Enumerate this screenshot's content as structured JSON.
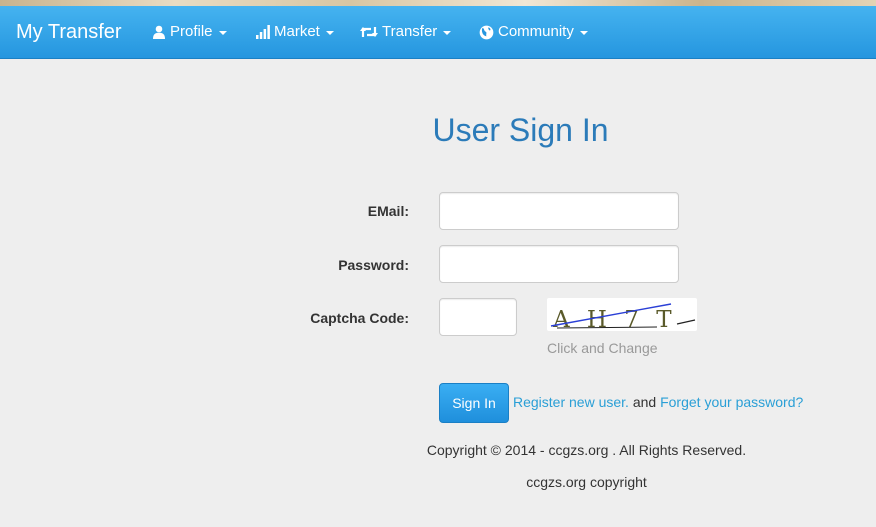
{
  "navbar": {
    "brand": "My Transfer",
    "items": [
      {
        "label": "Profile",
        "icon": "user-icon"
      },
      {
        "label": "Market",
        "icon": "signal-bars-icon"
      },
      {
        "label": "Transfer",
        "icon": "retweet-icon"
      },
      {
        "label": "Community",
        "icon": "globe-icon"
      }
    ]
  },
  "form": {
    "title": "User Sign In",
    "email_label": "EMail:",
    "email_value": "",
    "password_label": "Password:",
    "password_value": "",
    "captcha_label": "Captcha Code:",
    "captcha_value": "",
    "captcha_image_text": "A H 7 T",
    "captcha_hint": "Click and Change",
    "submit_label": "Sign In",
    "register_link": "Register new user.",
    "and_text": "and",
    "forgot_link": "Forget your password?"
  },
  "footer": {
    "copyright": "Copyright © 2014 - ccgzs.org . All Rights Reserved.",
    "tagline": "ccgzs.org copyright"
  },
  "colors": {
    "navbar": "#2596df",
    "title": "#2b7bb9",
    "link": "#2a9fd6",
    "background": "#eeeeee"
  }
}
